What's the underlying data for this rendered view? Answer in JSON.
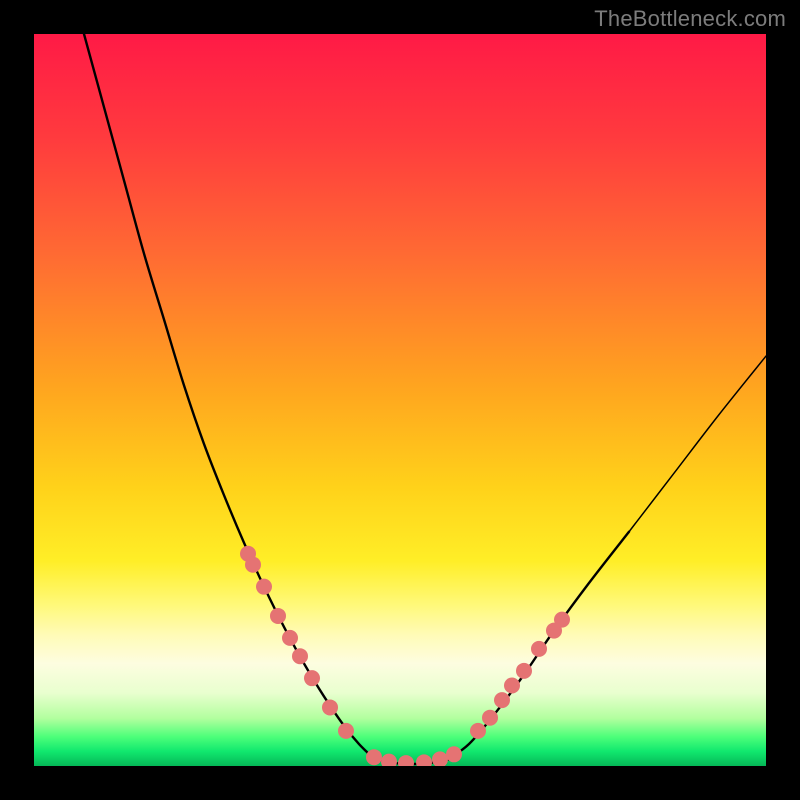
{
  "watermark": "TheBottleneck.com",
  "chart_data": {
    "type": "line",
    "title": "",
    "xlabel": "",
    "ylabel": "",
    "xlim": [
      0,
      732
    ],
    "ylim_bottleneck_pct": [
      0,
      100
    ],
    "curves": [
      {
        "name": "left",
        "x": [
          50,
          70,
          90,
          110,
          130,
          150,
          170,
          190,
          210,
          230,
          250,
          270,
          290,
          310,
          325,
          340
        ],
        "y_pct": [
          100,
          90,
          80,
          70,
          61,
          52,
          44,
          37,
          30.5,
          24.5,
          19,
          14,
          9.5,
          5.5,
          3,
          1
        ]
      },
      {
        "name": "floor",
        "x": [
          340,
          355,
          370,
          385,
          400,
          415
        ],
        "y_pct": [
          1,
          0.5,
          0.3,
          0.3,
          0.5,
          1
        ]
      },
      {
        "name": "right",
        "x": [
          415,
          435,
          460,
          490,
          520,
          555,
          595,
          640,
          685,
          732
        ],
        "y_pct": [
          1,
          3,
          7,
          12.5,
          18.5,
          25,
          32,
          40,
          48,
          56
        ]
      }
    ],
    "markers": {
      "left_branch": [
        {
          "x": 214,
          "y_pct": 29
        },
        {
          "x": 219,
          "y_pct": 27.5
        },
        {
          "x": 230,
          "y_pct": 24.5
        },
        {
          "x": 244,
          "y_pct": 20.5
        },
        {
          "x": 256,
          "y_pct": 17.5
        },
        {
          "x": 266,
          "y_pct": 15
        },
        {
          "x": 278,
          "y_pct": 12
        },
        {
          "x": 296,
          "y_pct": 8
        },
        {
          "x": 312,
          "y_pct": 4.8
        }
      ],
      "bottom": [
        {
          "x": 340,
          "y_pct": 1.2
        },
        {
          "x": 355,
          "y_pct": 0.6
        },
        {
          "x": 372,
          "y_pct": 0.4
        },
        {
          "x": 390,
          "y_pct": 0.5
        },
        {
          "x": 406,
          "y_pct": 0.9
        },
        {
          "x": 420,
          "y_pct": 1.6
        }
      ],
      "right_branch": [
        {
          "x": 444,
          "y_pct": 4.8
        },
        {
          "x": 456,
          "y_pct": 6.6
        },
        {
          "x": 468,
          "y_pct": 9
        },
        {
          "x": 478,
          "y_pct": 11
        },
        {
          "x": 490,
          "y_pct": 13
        },
        {
          "x": 505,
          "y_pct": 16
        },
        {
          "x": 520,
          "y_pct": 18.5
        },
        {
          "x": 528,
          "y_pct": 20
        }
      ]
    },
    "gradient_stops_pct_from_top": [
      {
        "pct": 0,
        "color": "#ff1a46"
      },
      {
        "pct": 14,
        "color": "#ff3a3e"
      },
      {
        "pct": 30,
        "color": "#ff6a33"
      },
      {
        "pct": 48,
        "color": "#ffa41f"
      },
      {
        "pct": 62,
        "color": "#ffd21a"
      },
      {
        "pct": 72,
        "color": "#ffee27"
      },
      {
        "pct": 78,
        "color": "#fff97a"
      },
      {
        "pct": 82,
        "color": "#fffbb6"
      },
      {
        "pct": 86,
        "color": "#fdfde0"
      },
      {
        "pct": 90,
        "color": "#e9ffcf"
      },
      {
        "pct": 93.5,
        "color": "#b2ff9e"
      },
      {
        "pct": 96,
        "color": "#4dff7a"
      },
      {
        "pct": 98,
        "color": "#11e86e"
      },
      {
        "pct": 100,
        "color": "#05b757"
      }
    ],
    "marker_style": {
      "r": 8,
      "fill": "#e57373",
      "stroke": "none"
    },
    "curve_style": {
      "stroke": "#000000",
      "width_main": 2.4,
      "width_right_thin": 1.5
    }
  }
}
